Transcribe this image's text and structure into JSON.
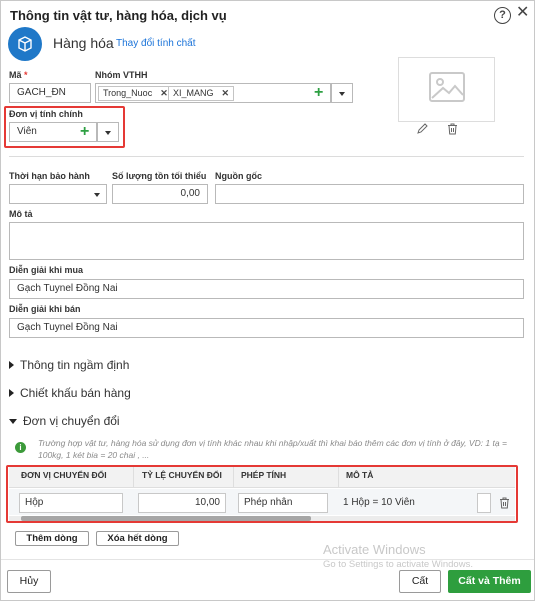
{
  "dialog": {
    "title": "Thông tin vật tư, hàng hóa, dịch vụ",
    "help_icon": "help-icon",
    "close_icon": "close-icon"
  },
  "item_type": {
    "icon": "box-icon",
    "name": "Hàng hóa",
    "change_link": "Thay đổi tính chất"
  },
  "code": {
    "label": "Mã",
    "required_mark": "*",
    "value": "GACH_ĐN"
  },
  "group": {
    "label": "Nhóm VTHH",
    "tags": [
      "Trong_Nuoc",
      "XI_MANG"
    ]
  },
  "unit": {
    "label": "Đơn vị tính chính",
    "value": "Viên"
  },
  "image": {
    "icon": "image-placeholder-icon",
    "edit_icon": "pencil-icon",
    "delete_icon": "trash-icon"
  },
  "warranty": {
    "label": "Thời hạn bảo hành",
    "value": ""
  },
  "min_stock": {
    "label": "Số lượng tồn tối thiểu",
    "value": "0,00"
  },
  "origin": {
    "label": "Nguồn gốc",
    "value": ""
  },
  "description": {
    "label": "Mô tả",
    "value": ""
  },
  "purchase_desc": {
    "label": "Diễn giải khi mua",
    "value": "Gạch Tuynel Đồng Nai"
  },
  "sale_desc": {
    "label": "Diễn giải khi bán",
    "value": "Gạch Tuynel Đồng Nai"
  },
  "sections": {
    "default_info": "Thông tin ngầm định",
    "sales_discount": "Chiết khấu bán hàng",
    "conversion_units": "Đơn vị chuyển đổi"
  },
  "conversion_note": "Trường hợp vật tư, hàng hóa sử dụng đơn vị tính khác nhau khi nhập/xuất thì khai báo thêm các đơn vị tính ở đây, VD: 1 tạ = 100kg, 1 két bia = 20 chai , ...",
  "conversion_table": {
    "headers": [
      "ĐƠN VỊ CHUYỂN ĐỔI",
      "TỶ LỆ CHUYỂN ĐỔI",
      "PHÉP TÍNH",
      "MÔ TẢ"
    ],
    "rows": [
      {
        "unit": "Hộp",
        "ratio": "10,00",
        "operation": "Phép nhân",
        "description": "1 Hộp = 10 Viên"
      }
    ]
  },
  "table_buttons": {
    "add_row": "Thêm dòng",
    "delete_all": "Xóa hết dòng"
  },
  "watermark": {
    "line1": "Activate Windows",
    "line2": "Go to Settings to activate Windows."
  },
  "footer": {
    "cancel": "Hủy",
    "save": "Cất",
    "save_and_add": "Cất và Thêm"
  },
  "colors": {
    "accent_blue": "#1f78c8",
    "link_blue": "#1a73d9",
    "highlight_red": "#e53935",
    "primary_green": "#2e9e3e"
  }
}
